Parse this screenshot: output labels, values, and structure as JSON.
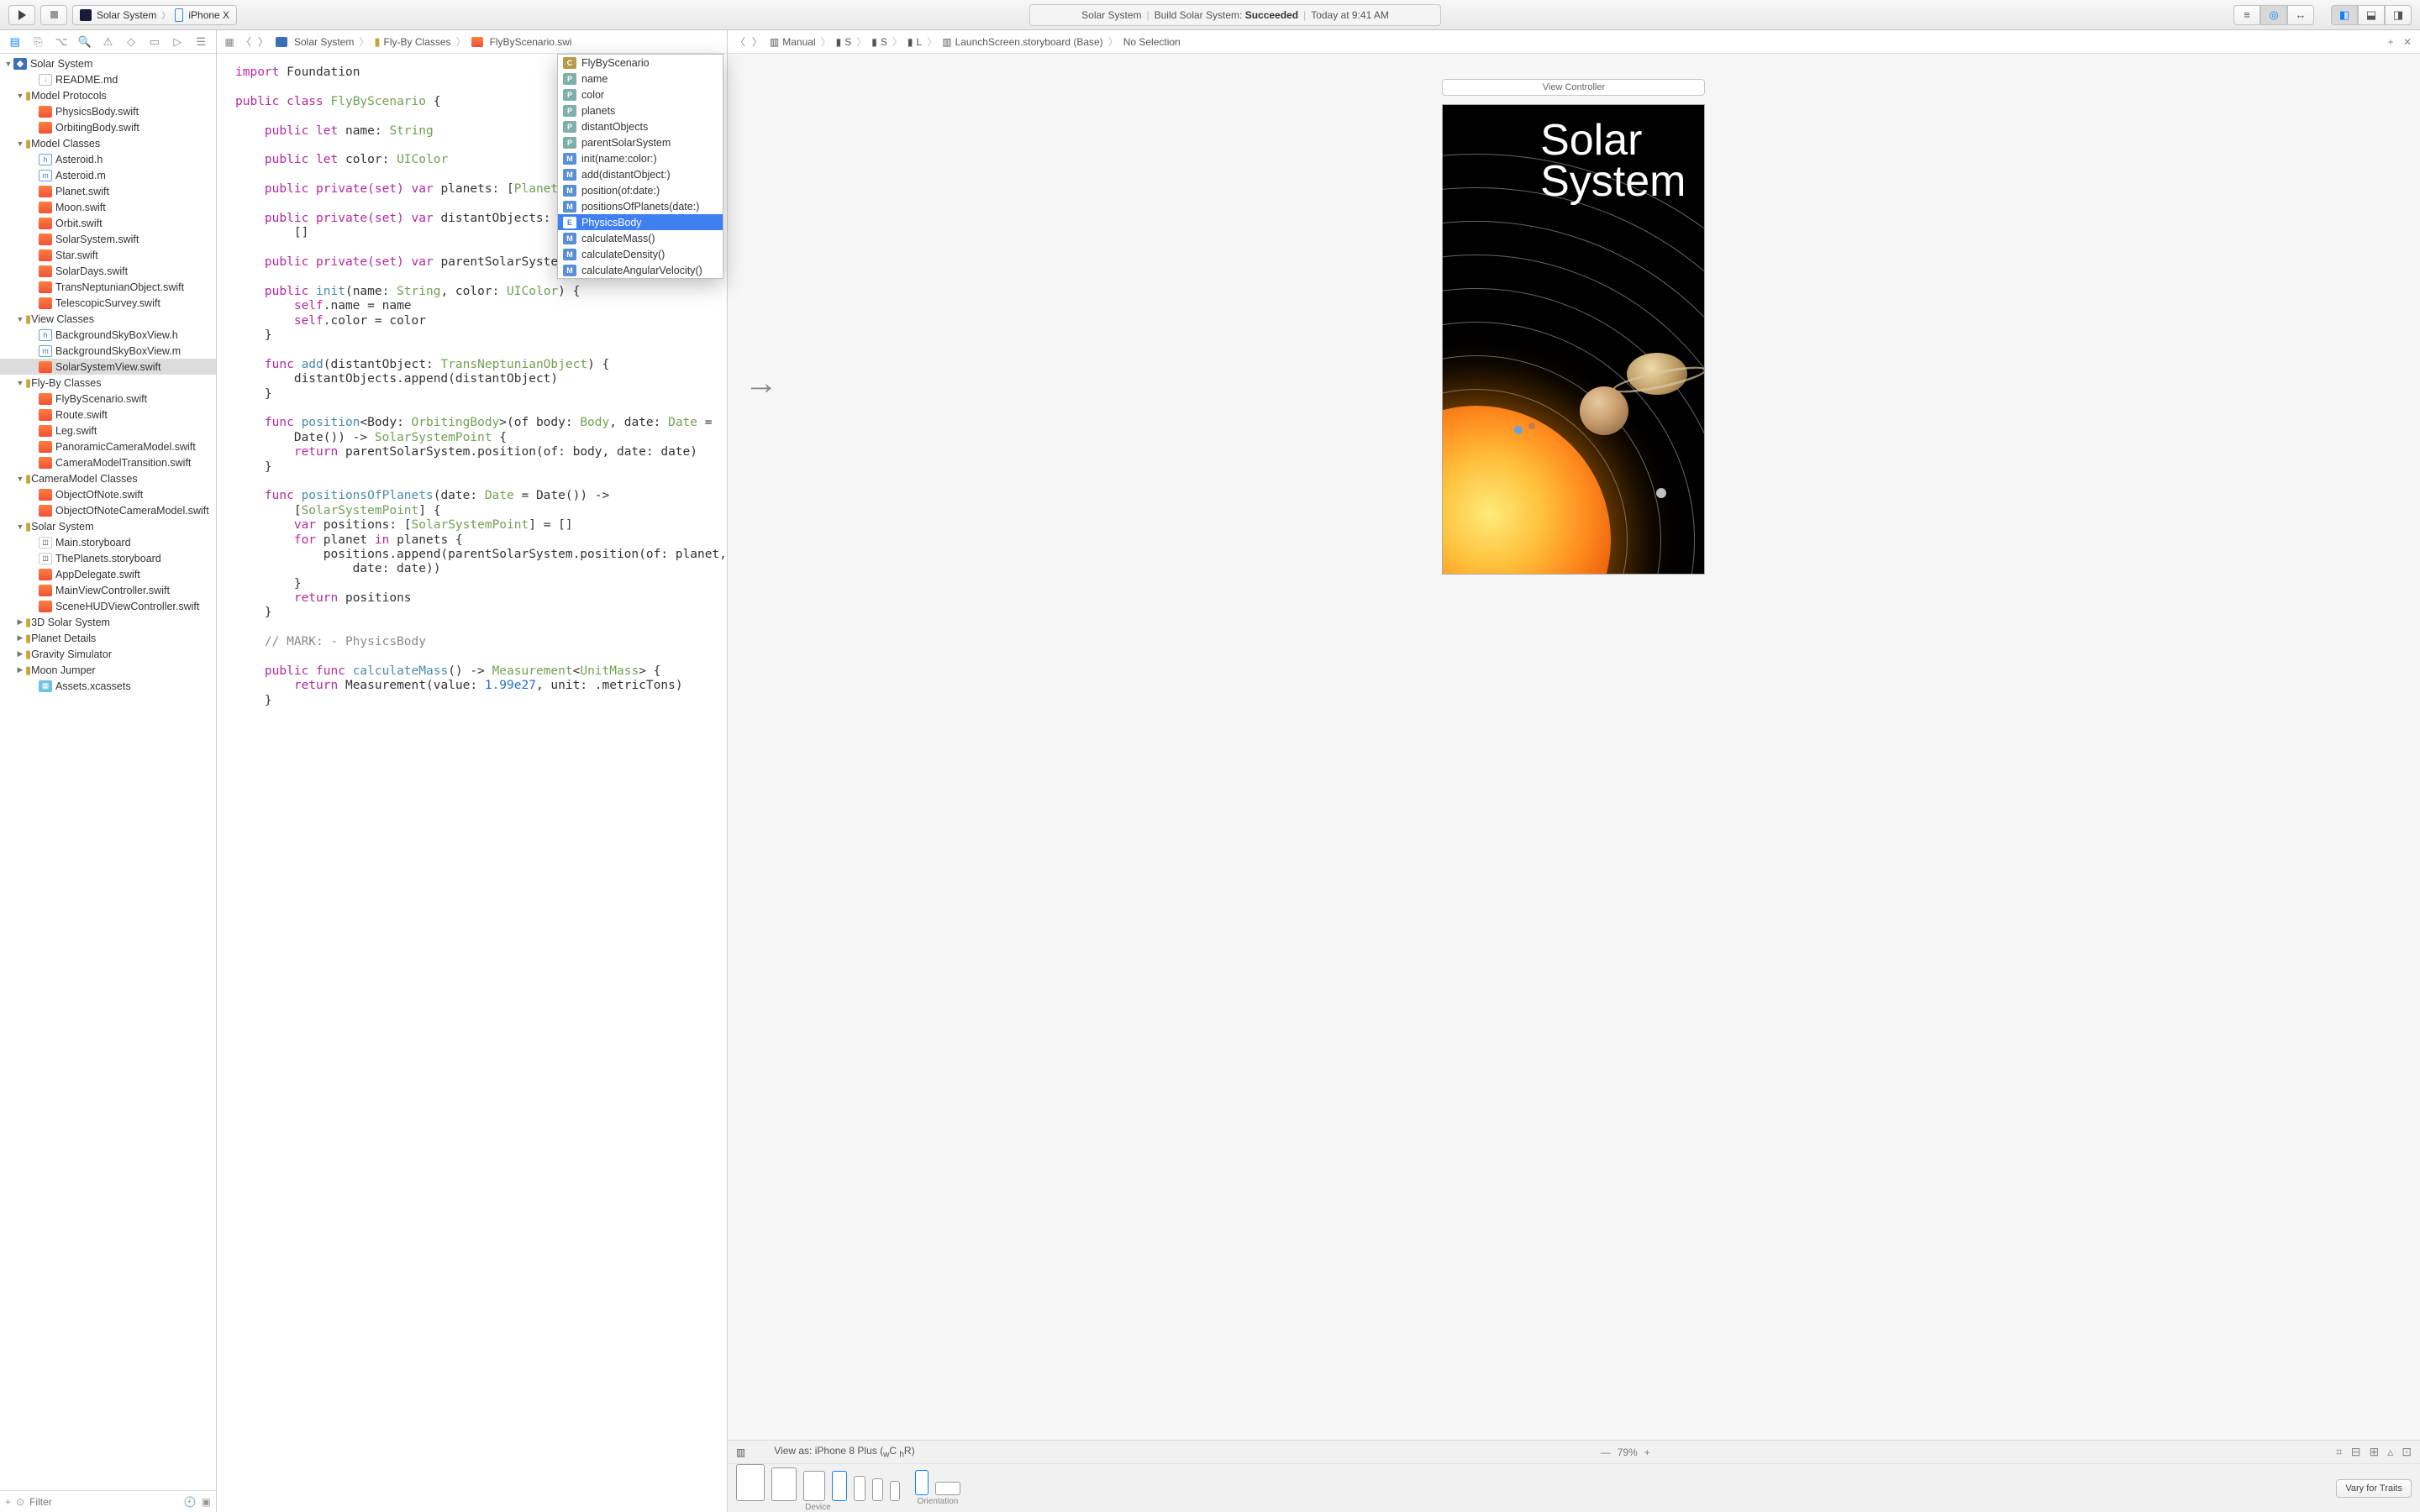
{
  "toolbar": {
    "scheme_project": "Solar System",
    "scheme_device": "iPhone X",
    "activity_project": "Solar System",
    "activity_action": "Build Solar System:",
    "activity_status": "Succeeded",
    "activity_time": "Today at 9:41 AM"
  },
  "navigator": {
    "root": "Solar System",
    "groups": [
      {
        "type": "file",
        "indent": 2,
        "icon": "md",
        "label": "README.md"
      },
      {
        "type": "group",
        "indent": 1,
        "label": "Model Protocols"
      },
      {
        "type": "file",
        "indent": 2,
        "icon": "swift",
        "label": "PhysicsBody.swift"
      },
      {
        "type": "file",
        "indent": 2,
        "icon": "swift",
        "label": "OrbitingBody.swift"
      },
      {
        "type": "group",
        "indent": 1,
        "label": "Model Classes"
      },
      {
        "type": "file",
        "indent": 2,
        "icon": "h",
        "label": "Asteroid.h"
      },
      {
        "type": "file",
        "indent": 2,
        "icon": "m",
        "label": "Asteroid.m"
      },
      {
        "type": "file",
        "indent": 2,
        "icon": "swift",
        "label": "Planet.swift"
      },
      {
        "type": "file",
        "indent": 2,
        "icon": "swift",
        "label": "Moon.swift"
      },
      {
        "type": "file",
        "indent": 2,
        "icon": "swift",
        "label": "Orbit.swift"
      },
      {
        "type": "file",
        "indent": 2,
        "icon": "swift",
        "label": "SolarSystem.swift"
      },
      {
        "type": "file",
        "indent": 2,
        "icon": "swift",
        "label": "Star.swift"
      },
      {
        "type": "file",
        "indent": 2,
        "icon": "swift",
        "label": "SolarDays.swift"
      },
      {
        "type": "file",
        "indent": 2,
        "icon": "swift",
        "label": "TransNeptunianObject.swift"
      },
      {
        "type": "file",
        "indent": 2,
        "icon": "swift",
        "label": "TelescopicSurvey.swift"
      },
      {
        "type": "group",
        "indent": 1,
        "label": "View Classes"
      },
      {
        "type": "file",
        "indent": 2,
        "icon": "h",
        "label": "BackgroundSkyBoxView.h"
      },
      {
        "type": "file",
        "indent": 2,
        "icon": "m",
        "label": "BackgroundSkyBoxView.m"
      },
      {
        "type": "file",
        "indent": 2,
        "icon": "swift",
        "label": "SolarSystemView.swift",
        "selected": true
      },
      {
        "type": "group",
        "indent": 1,
        "label": "Fly-By Classes"
      },
      {
        "type": "file",
        "indent": 2,
        "icon": "swift",
        "label": "FlyByScenario.swift"
      },
      {
        "type": "file",
        "indent": 2,
        "icon": "swift",
        "label": "Route.swift"
      },
      {
        "type": "file",
        "indent": 2,
        "icon": "swift",
        "label": "Leg.swift"
      },
      {
        "type": "file",
        "indent": 2,
        "icon": "swift",
        "label": "PanoramicCameraModel.swift"
      },
      {
        "type": "file",
        "indent": 2,
        "icon": "swift",
        "label": "CameraModelTransition.swift"
      },
      {
        "type": "group",
        "indent": 1,
        "label": "CameraModel Classes"
      },
      {
        "type": "file",
        "indent": 2,
        "icon": "swift",
        "label": "ObjectOfNote.swift"
      },
      {
        "type": "file",
        "indent": 2,
        "icon": "swift",
        "label": "ObjectOfNoteCameraModel.swift"
      },
      {
        "type": "group",
        "indent": 1,
        "label": "Solar System"
      },
      {
        "type": "file",
        "indent": 2,
        "icon": "sb",
        "label": "Main.storyboard"
      },
      {
        "type": "file",
        "indent": 2,
        "icon": "sb",
        "label": "ThePlanets.storyboard"
      },
      {
        "type": "file",
        "indent": 2,
        "icon": "swift",
        "label": "AppDelegate.swift"
      },
      {
        "type": "file",
        "indent": 2,
        "icon": "swift",
        "label": "MainViewController.swift"
      },
      {
        "type": "file",
        "indent": 2,
        "icon": "swift",
        "label": "SceneHUDViewController.swift"
      },
      {
        "type": "groupc",
        "indent": 1,
        "label": "3D Solar System"
      },
      {
        "type": "groupc",
        "indent": 1,
        "label": "Planet Details"
      },
      {
        "type": "groupc",
        "indent": 1,
        "label": "Gravity Simulator"
      },
      {
        "type": "groupc",
        "indent": 1,
        "label": "Moon Jumper"
      },
      {
        "type": "file",
        "indent": 2,
        "icon": "assets",
        "label": "Assets.xcassets"
      }
    ],
    "filter_placeholder": "Filter"
  },
  "primary_jumpbar": {
    "segs": [
      "Solar System",
      "Fly-By Classes",
      "FlyByScenario.swi"
    ]
  },
  "assistant_jumpbar": {
    "mode": "Manual",
    "segs": [
      "S",
      "S",
      "L",
      "LaunchScreen.storyboard (Base)",
      "No Selection"
    ]
  },
  "autocomplete": {
    "items": [
      {
        "k": "C",
        "label": "FlyByScenario"
      },
      {
        "k": "P",
        "label": "name"
      },
      {
        "k": "P",
        "label": "color"
      },
      {
        "k": "P",
        "label": "planets"
      },
      {
        "k": "P",
        "label": "distantObjects"
      },
      {
        "k": "P",
        "label": "parentSolarSystem"
      },
      {
        "k": "M",
        "label": "init(name:color:)"
      },
      {
        "k": "M",
        "label": "add(distantObject:)"
      },
      {
        "k": "M",
        "label": "position(of:date:)"
      },
      {
        "k": "M",
        "label": "positionsOfPlanets(date:)"
      },
      {
        "k": "E",
        "label": "PhysicsBody",
        "hl": true
      },
      {
        "k": "M",
        "label": "calculateMass()"
      },
      {
        "k": "M",
        "label": "calculateDensity()"
      },
      {
        "k": "M",
        "label": "calculateAngularVelocity()"
      }
    ]
  },
  "code_lines": [
    "<span class='kw'>import</span> Foundation",
    "",
    "<span class='kw'>public class</span> <span class='typ'>FlyByScenario</span> {",
    "",
    "    <span class='kw'>public let</span> name: <span class='typ'>String</span>",
    "",
    "    <span class='kw'>public let</span> color: <span class='typ'>UIColor</span>",
    "",
    "    <span class='kw'>public private(set) var</span> planets: [<span class='typ'>Planet</span>]",
    "",
    "    <span class='kw'>public private(set) var</span> distantObjects: [<span class='typ'>T</span>",
    "        []",
    "",
    "    <span class='kw'>public private(set) var</span> parentSolarSystem:",
    "",
    "    <span class='kw'>public</span> <span class='fn'>init</span>(name: <span class='typ'>String</span>, color: <span class='typ'>UIColor</span>) {",
    "        <span class='self'>self</span>.name = name",
    "        <span class='self'>self</span>.color = color",
    "    }",
    "",
    "    <span class='kw'>func</span> <span class='fn'>add</span>(distantObject: <span class='typ'>TransNeptunianObject</span>) {",
    "        distantObjects.append(distantObject)",
    "    }",
    "",
    "    <span class='kw'>func</span> <span class='fn'>position</span>&lt;Body: <span class='typ'>OrbitingBody</span>&gt;(of body: <span class='typ'>Body</span>, date: <span class='typ'>Date</span> =",
    "        Date()) -> <span class='typ'>SolarSystemPoint</span> {",
    "        <span class='kw'>return</span> parentSolarSystem.position(of: body, date: date)",
    "    }",
    "",
    "    <span class='kw'>func</span> <span class='fn'>positionsOfPlanets</span>(date: <span class='typ'>Date</span> = Date()) ->",
    "        [<span class='typ'>SolarSystemPoint</span>] {",
    "        <span class='kw'>var</span> positions: [<span class='typ'>SolarSystemPoint</span>] = []",
    "        <span class='kw'>for</span> planet <span class='kw'>in</span> planets {",
    "            positions.append(parentSolarSystem.position(of: planet,",
    "                date: date))",
    "        }",
    "        <span class='kw'>return</span> positions",
    "    }",
    "",
    "    <span class='cmt'>// MARK: - PhysicsBody</span>",
    "",
    "    <span class='kw'>public func</span> <span class='fn'>calculateMass</span>() -> <span class='typ'>Measurement</span>&lt;<span class='typ'>UnitMass</span>&gt; {",
    "        <span class='kw'>return</span> Measurement(value: <span class='num'>1.99e27</span>, unit: .metricTons)",
    "    }"
  ],
  "ib": {
    "vc_label": "View Controller",
    "title_line1": "Solar",
    "title_line2": "System"
  },
  "device_bar": {
    "view_as": "View as: iPhone 8 Plus (",
    "wC": "C",
    "hR": "R)",
    "zoom": "79%",
    "device_label": "Device",
    "orientation_label": "Orientation",
    "vary": "Vary for Traits"
  }
}
